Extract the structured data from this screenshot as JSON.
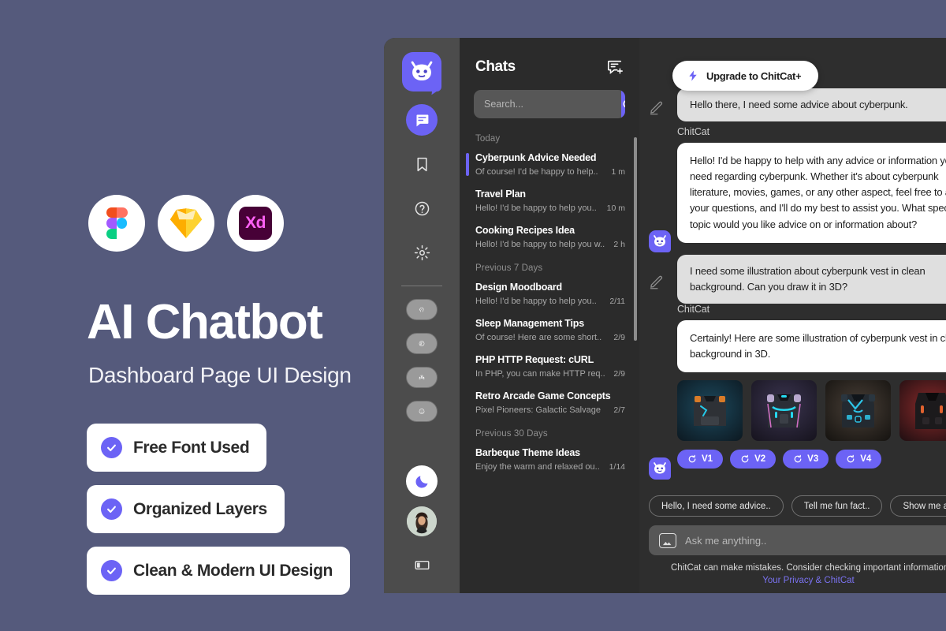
{
  "promo": {
    "title": "AI Chatbot",
    "subtitle": "Dashboard Page UI Design",
    "tools": [
      {
        "name": "figma",
        "label": "Figma"
      },
      {
        "name": "sketch",
        "label": "Sketch"
      },
      {
        "name": "adobe-xd",
        "label": "Xd"
      }
    ],
    "badges": [
      "Free Font Used",
      "Organized Layers",
      "Clean & Modern UI Design"
    ],
    "background_color": "#555a7c",
    "accent_color": "#6c63f5"
  },
  "app": {
    "rail": {
      "brand": "ChitCat",
      "items": [
        {
          "icon": "chat-bubble-icon",
          "state": "active"
        },
        {
          "icon": "bookmark-icon",
          "state": "default"
        },
        {
          "icon": "help-circle-icon",
          "state": "default"
        },
        {
          "icon": "gear-icon",
          "state": "default"
        },
        {
          "icon": "voice-assistant-icon",
          "state": "chip"
        },
        {
          "icon": "image-assistant-icon",
          "state": "chip"
        },
        {
          "icon": "community-icon",
          "state": "chip"
        },
        {
          "icon": "smiley-icon",
          "state": "chip"
        },
        {
          "icon": "moon-icon",
          "state": "light"
        },
        {
          "icon": "user-avatar",
          "state": "avatar"
        },
        {
          "icon": "sidebar-toggle-icon",
          "state": "default"
        }
      ]
    },
    "chats": {
      "title": "Chats",
      "new_chat_icon": "new-chat-icon",
      "search": {
        "value": "",
        "placeholder": "Search..."
      },
      "groups": [
        {
          "label": "Today",
          "items": [
            {
              "title": "Cyberpunk Advice Needed",
              "snippet": "Of course! I'd be happy to help..",
              "time": "1 m",
              "active": true
            },
            {
              "title": "Travel Plan",
              "snippet": "Hello! I'd be happy to help you..",
              "time": "10 m",
              "active": false
            },
            {
              "title": "Cooking Recipes Idea",
              "snippet": "Hello! I'd be happy to help you w..",
              "time": "2 h",
              "active": false
            }
          ]
        },
        {
          "label": "Previous 7 Days",
          "items": [
            {
              "title": "Design Moodboard",
              "snippet": "Hello! I'd be happy to help you..",
              "time": "2/11",
              "active": false
            },
            {
              "title": "Sleep Management Tips",
              "snippet": "Of course! Here are some short..",
              "time": "2/9",
              "active": false
            },
            {
              "title": "PHP HTTP Request: cURL",
              "snippet": "In PHP, you can make HTTP req..",
              "time": "2/9",
              "active": false
            },
            {
              "title": "Retro Arcade Game Concepts",
              "snippet": "Pixel Pioneers: Galactic Salvage",
              "time": "2/7",
              "active": false
            }
          ]
        },
        {
          "label": "Previous 30 Days",
          "items": [
            {
              "title": "Barbeque Theme Ideas",
              "snippet": "Enjoy the warm and relaxed ou..",
              "time": "1/14",
              "active": false
            }
          ]
        }
      ]
    },
    "conversation": {
      "upgrade_label": "Upgrade to ChitCat+",
      "bot_name": "ChitCat",
      "messages": [
        {
          "role": "user",
          "text": "Hello there, I need some advice about cyberpunk."
        },
        {
          "role": "bot",
          "sender": "ChitCat",
          "text": "Hello! I'd be happy to help with any advice or information you need regarding cyberpunk. Whether it's about cyberpunk literature, movies, games, or any other aspect, feel free to ask your questions, and I'll do my best to assist you. What specific topic would you like advice on or information about?"
        },
        {
          "role": "user",
          "text": "I need some illustration about cyberpunk vest in clean background. Can you draw it in 3D?"
        },
        {
          "role": "bot",
          "sender": "ChitCat",
          "text": "Certainly! Here are some illustration of cyberpunk vest in clean background in 3D.",
          "gallery": [
            {
              "alt": "cyberpunk vest teal glow",
              "version": "V1"
            },
            {
              "alt": "cyberpunk vest pink trim",
              "version": "V2"
            },
            {
              "alt": "cyberpunk vest tactical blue",
              "version": "V3"
            },
            {
              "alt": "cyberpunk vest red backlight",
              "version": "V4"
            }
          ]
        }
      ],
      "suggestions": [
        "Hello, I need some advice..",
        "Tell me fun fact..",
        "Show me a code snippet.."
      ],
      "composer": {
        "placeholder": "Ask me anything..",
        "value": "",
        "attach_icon": "image-attach-icon"
      },
      "disclaimer": "ChitCat can make mistakes. Consider checking important information.",
      "disclaimer_link": "Your Privacy & ChitCat"
    }
  }
}
